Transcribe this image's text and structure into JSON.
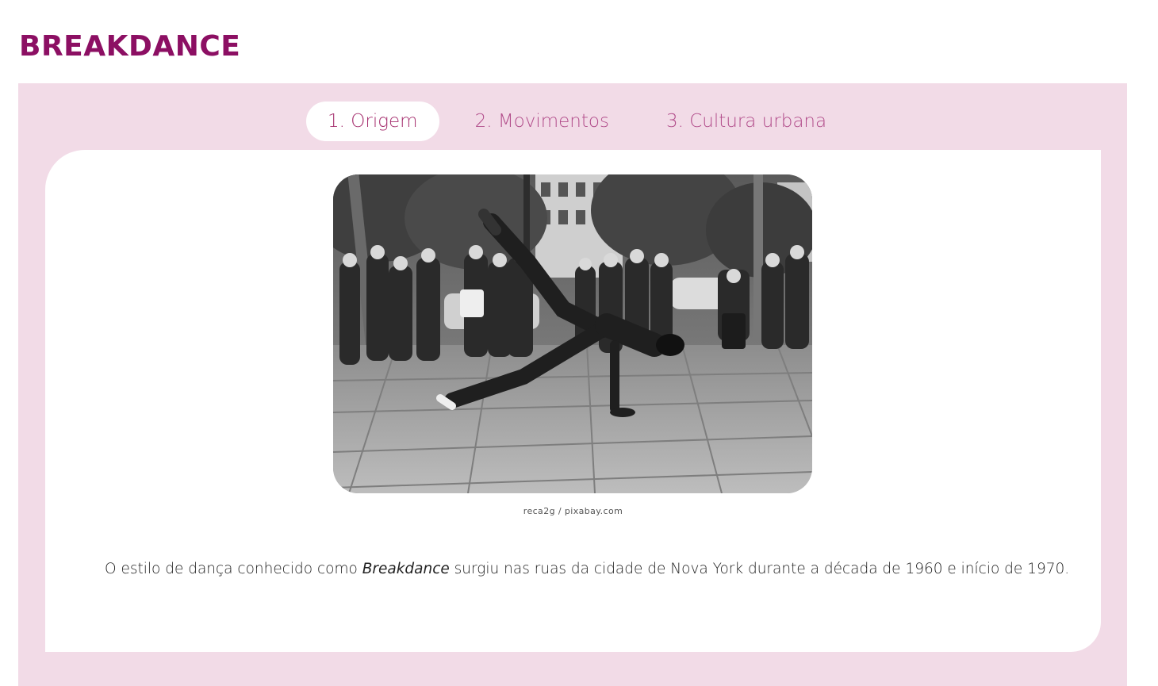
{
  "page": {
    "title": "BREAKDANCE"
  },
  "tabs": [
    {
      "label": "1. Origem",
      "active": true
    },
    {
      "label": "2. Movimentos",
      "active": false
    },
    {
      "label": "3. Cultura urbana",
      "active": false
    }
  ],
  "content": {
    "image_alt": "Dançarino de breakdance em uma praça cercado por pessoas",
    "credit": "reca2g / pixabay.com",
    "paragraph": {
      "before": "O estilo de dança conhecido como ",
      "emphasis": "Breakdance",
      "after": " surgiu nas ruas da cidade de Nova York durante a década de 1960 e início de 1970."
    }
  },
  "colors": {
    "title": "#8c0f63",
    "panel_bg": "#f2dbe7",
    "tab_text": "#b24d8b",
    "tab_active_bg": "#ffffff"
  }
}
